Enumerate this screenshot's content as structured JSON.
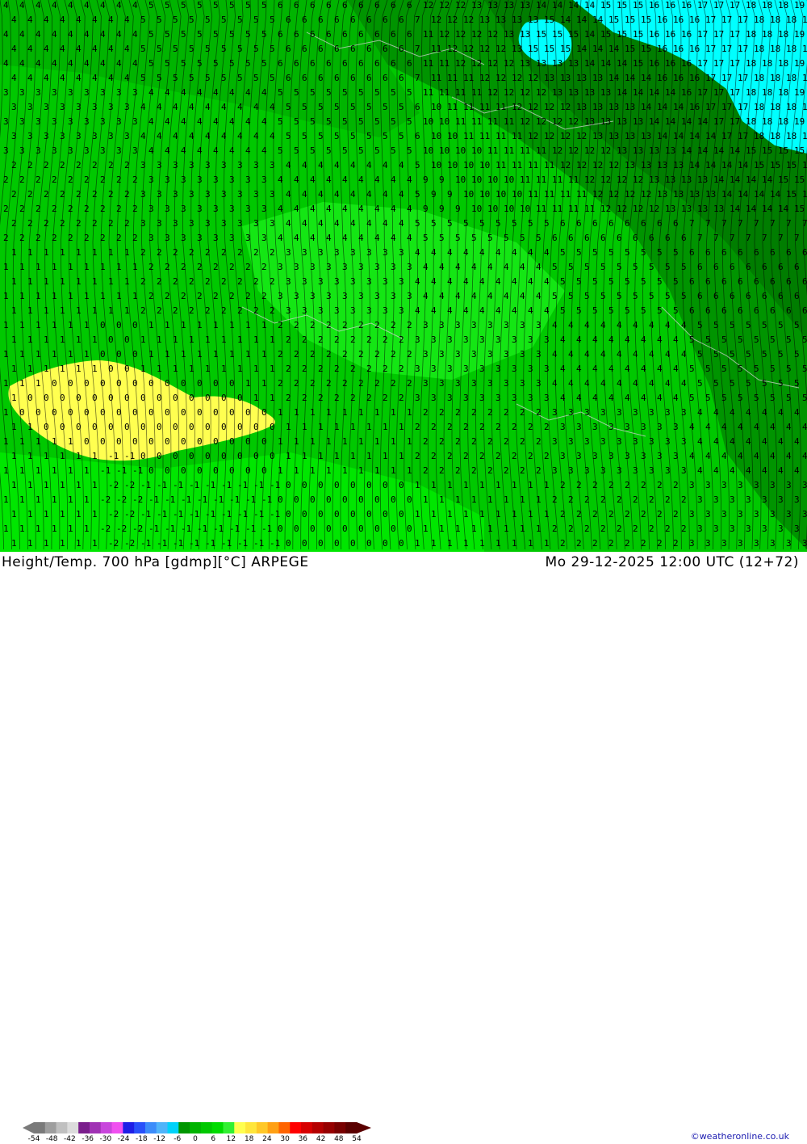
{
  "map": {
    "field_colors": {
      "dark": "#009400",
      "darker": "#007d00",
      "medium": "#00b400",
      "main": "#00c800",
      "bright": "#14e614",
      "lime": "#00e600",
      "cold": "#00ffff",
      "warm": "#ffff50"
    },
    "contour_color": "#000000",
    "border_color": "#d0d0d0"
  },
  "footer": {
    "title": "Height/Temp. 700 hPa [gdmp][°C] ARPEGE",
    "valid_time": "Mo 29-12-2025 12:00 UTC (12+72)",
    "credit": "©weatheronline.co.uk"
  },
  "scale": {
    "labels": [
      "-54",
      "-48",
      "-42",
      "-36",
      "-30",
      "-24",
      "-18",
      "-12",
      "-6",
      "0",
      "6",
      "12",
      "18",
      "24",
      "30",
      "36",
      "42",
      "48",
      "54"
    ],
    "colors": [
      "#7a7a7a",
      "#9e9e9e",
      "#c0c0c0",
      "#dcdcdc",
      "#7a1e8c",
      "#a032b4",
      "#c846dc",
      "#f050f0",
      "#1e1ee6",
      "#2850fa",
      "#3c8cfa",
      "#50b4fa",
      "#00d2fa",
      "#009600",
      "#00b400",
      "#00c800",
      "#00dc00",
      "#32f032",
      "#ffff50",
      "#ffe63c",
      "#ffc828",
      "#ffa014",
      "#ff6400",
      "#ff0000",
      "#d70000",
      "#b40000",
      "#960000",
      "#780000",
      "#5a0000"
    ]
  }
}
